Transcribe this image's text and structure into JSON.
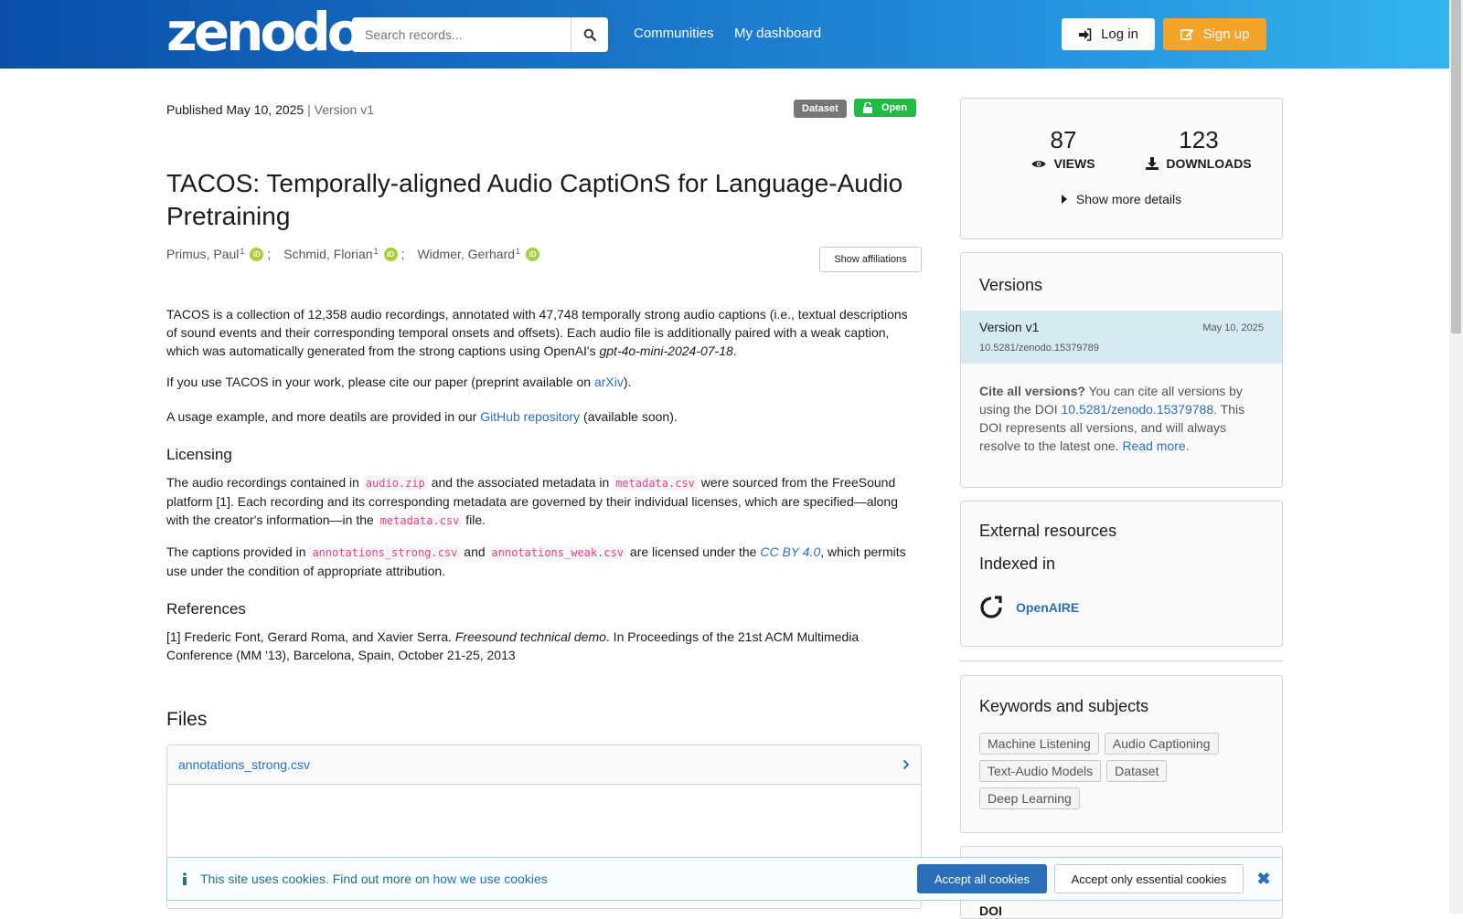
{
  "header": {
    "logo": "zenodo",
    "search_placeholder": "Search records...",
    "nav": [
      "Communities",
      "My dashboard"
    ],
    "login_label": "Log in",
    "signup_label": "Sign up"
  },
  "record": {
    "published": "Published May 10, 2025",
    "version": "| Version v1",
    "resource_type": "Dataset",
    "access": "Open",
    "title": "TACOS: Temporally-aligned Audio CaptiOnS for Language-Audio Pretraining",
    "authors": [
      {
        "name": "Primus, Paul",
        "aff": "1"
      },
      {
        "name": "Schmid, Florian",
        "aff": "1"
      },
      {
        "name": "Widmer, Gerhard",
        "aff": "1"
      }
    ],
    "show_affiliations": "Show affiliations"
  },
  "description": {
    "p1_a": "TACOS is a collection of 12,358 audio recordings, annotated with 47,748 temporally strong audio captions (i.e., textual descriptions of sound events and their corresponding temporal onsets and offsets). Each audio file is additionally paired with a weak caption, which was automatically generated from the strong captions using OpenAI's ",
    "p1_model": "gpt-4o-mini-2024-07-18",
    "p1_end": ".",
    "p2_a": "If you use TACOS in your work, please cite our paper (preprint available on ",
    "p2_link": "arXiv",
    "p2_end": ").",
    "p3_a": "A usage example, and more deatils are provided in our ",
    "p3_link": "GitHub repository",
    "p3_end": " (available soon).",
    "h_licensing": "Licensing",
    "lic1_a": "The audio recordings contained in ",
    "lic1_code1": "audio.zip",
    "lic1_b": " and the associated metadata in ",
    "lic1_code2": "metadata.csv",
    "lic1_c": " were sourced from the FreeSound platform [1]. Each recording and its corresponding metadata are governed by their individual licenses, which are specified—along with the creator's information—in the ",
    "lic1_code3": "metadata.csv",
    "lic1_d": " file.",
    "lic2_a": "The captions provided in ",
    "lic2_code1": "annotations_strong.csv",
    "lic2_b": " and ",
    "lic2_code2": "annotations_weak.csv",
    "lic2_c": " are licensed under the ",
    "lic2_link": "CC BY 4.0",
    "lic2_d": ", which permits use under the condition of appropriate attribution.",
    "h_references": "References",
    "ref1_a": "[1] Frederic Font, Gerard Roma, and Xavier Serra. ",
    "ref1_title": "Freesound technical demo",
    "ref1_b": ". In Proceedings of the 21st ACM Multimedia Conference (MM '13), Barcelona, Spain, October 21-25, 2013"
  },
  "files": {
    "heading": "Files",
    "first_file": "annotations_strong.csv"
  },
  "stats": {
    "views": "87",
    "views_label": "VIEWS",
    "downloads": "123",
    "downloads_label": "DOWNLOADS",
    "more": "Show more details"
  },
  "versions": {
    "heading": "Versions",
    "current_name": "Version v1",
    "current_date": "May 10, 2025",
    "current_doi": "10.5281/zenodo.15379789",
    "cite_bold": "Cite all versions?",
    "cite_a": " You can cite all versions by using the DOI ",
    "cite_doi": "10.5281/zenodo.15379788",
    "cite_b": ". This DOI represents all versions, and will always resolve to the latest one. ",
    "read_more": "Read more."
  },
  "external": {
    "heading": "External resources",
    "indexed": "Indexed in",
    "openaire": "OpenAIRE"
  },
  "keywords": {
    "heading": "Keywords and subjects",
    "items": [
      "Machine Listening",
      "Audio Captioning",
      "Text-Audio Models",
      "Dataset",
      "Deep Learning"
    ]
  },
  "doi_box": {
    "label": "DOI"
  },
  "cookie": {
    "text": "This site uses cookies. Find out more on ",
    "link": "how we use cookies",
    "accept_all": "Accept all cookies",
    "accept_essential": "Accept only essential cookies"
  },
  "colors": {
    "accent": "#2a6ebb",
    "open_green": "#21ba45",
    "signup_orange": "#f2a42b"
  }
}
